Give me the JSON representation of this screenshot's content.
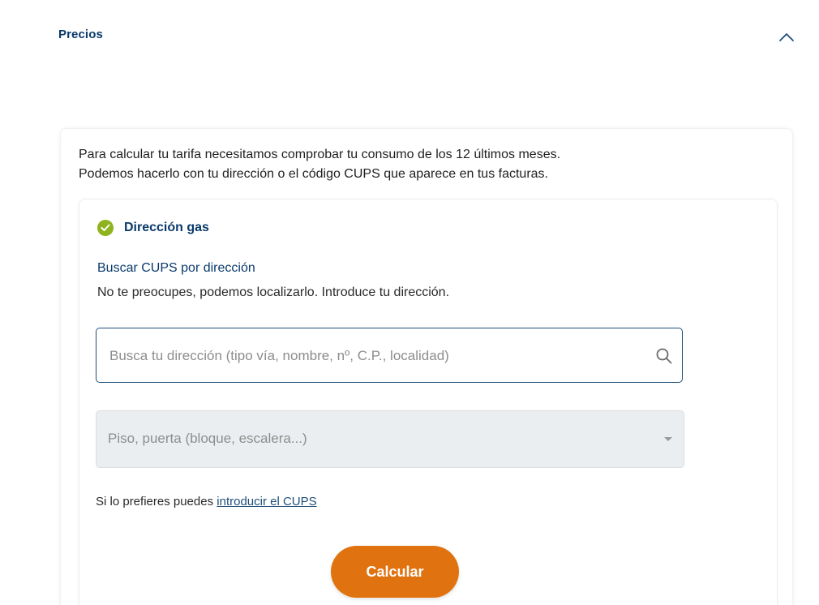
{
  "section": {
    "title": "Precios",
    "toggle_icon": "chevron-up-icon"
  },
  "intro": {
    "line1": "Para calcular tu tarifa necesitamos comprobar tu consumo de los 12 últimos meses.",
    "line2": "Podemos hacerlo con tu dirección o el código CUPS que aparece en tus facturas."
  },
  "step": {
    "icon": "check-circle-icon",
    "title": "Dirección gas"
  },
  "search": {
    "heading": "Buscar CUPS por dirección",
    "help": "No te preocupes, podemos localizarlo. Introduce tu dirección.",
    "placeholder": "Busca tu dirección (tipo vía, nombre, nº, C.P., localidad)",
    "value": "",
    "icon": "search-icon"
  },
  "floor": {
    "placeholder": "Piso, puerta (bloque, escalera...)",
    "icon": "caret-down-icon"
  },
  "cups": {
    "prefix": "Si lo prefieres puedes ",
    "link": "introducir el CUPS"
  },
  "actions": {
    "calculate_label": "Calcular"
  },
  "colors": {
    "primary_blue": "#0a3a6b",
    "accent_orange": "#e0730f",
    "success_green": "#8fb31e",
    "disabled_bg": "#ebeef0"
  }
}
